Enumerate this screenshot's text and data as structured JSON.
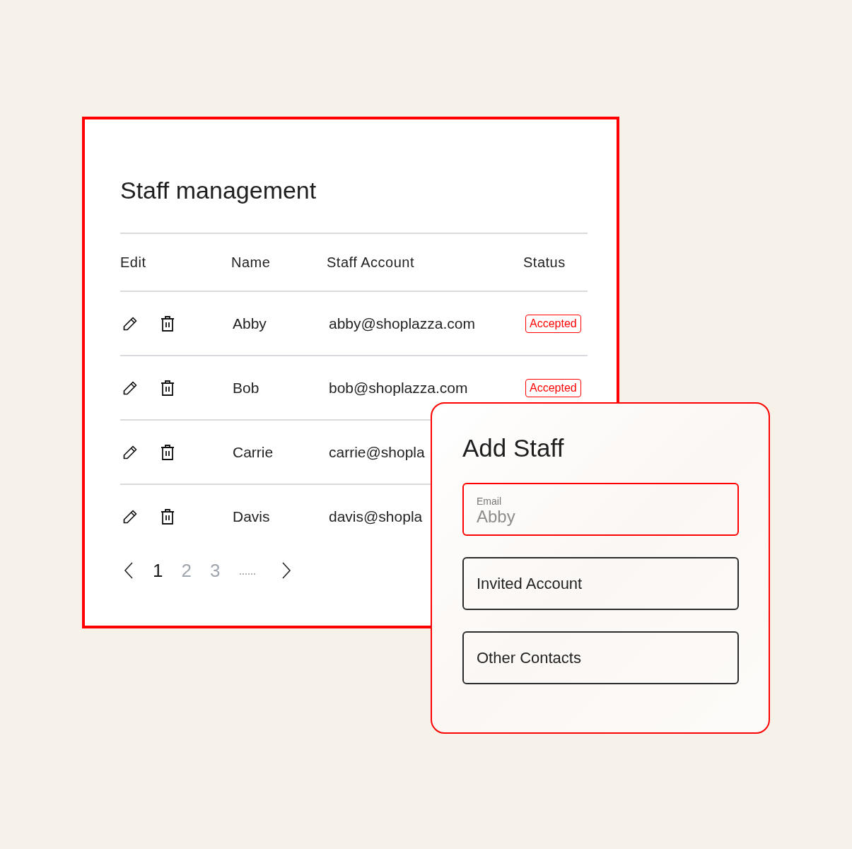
{
  "table_card": {
    "title": "Staff management",
    "columns": [
      "Edit",
      "Name",
      "Staff Account",
      "Status"
    ],
    "rows": [
      {
        "name": "Abby",
        "account": "abby@shoplazza.com",
        "status": "Accepted"
      },
      {
        "name": "Bob",
        "account": "bob@shoplazza.com",
        "status": "Accepted"
      },
      {
        "name": "Carrie",
        "account": "carrie@shopla"
      },
      {
        "name": "Davis",
        "account": "davis@shopla"
      }
    ],
    "pagination": {
      "pages": [
        {
          "label": "1",
          "selected": true
        },
        {
          "label": "2",
          "selected": false
        },
        {
          "label": "3",
          "selected": false
        }
      ],
      "ellipsis": "......"
    }
  },
  "add_staff": {
    "title": "Add Staff",
    "fields": [
      {
        "label": "Email",
        "placeholder": "Abby",
        "focused": true
      },
      {
        "placeholder": "Invited Account",
        "focused": false
      },
      {
        "placeholder": "Other Contacts",
        "focused": false
      }
    ]
  }
}
